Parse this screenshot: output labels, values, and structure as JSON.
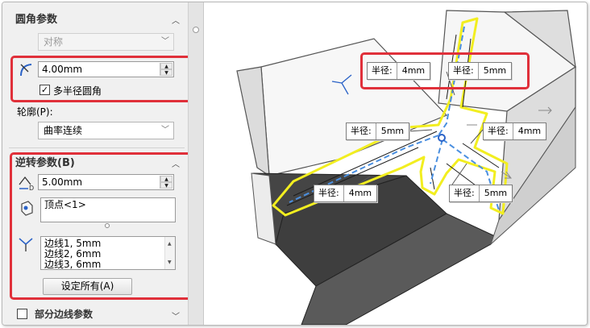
{
  "fillet_params": {
    "title": "圆角参数",
    "method": "对称",
    "radius": "4.00mm",
    "multi_radius_label": "多半径圆角",
    "multi_radius_checked": "✓"
  },
  "profile": {
    "label": "轮廓(P):",
    "value": "曲率连续"
  },
  "setback_params": {
    "title": "逆转参数(B)",
    "distance": "5.00mm",
    "vertex": "顶点<1>",
    "edges": [
      "边线1, 5mm",
      "边线2, 6mm",
      "边线3, 6mm"
    ],
    "set_all_button": "设定所有(A)"
  },
  "partial_edge": {
    "label": "部分边线参数"
  },
  "callouts": [
    {
      "key": "半径:",
      "value": "4mm"
    },
    {
      "key": "半径:",
      "value": "5mm"
    },
    {
      "key": "半径:",
      "value": "5mm"
    },
    {
      "key": "半径:",
      "value": "4mm"
    },
    {
      "key": "半径:",
      "value": "4mm"
    },
    {
      "key": "半径:",
      "value": "5mm"
    }
  ],
  "colors": {
    "highlight": "#e0303a",
    "edge_yellow": "#f2ee20",
    "preview_blue": "#4a8fe0"
  }
}
